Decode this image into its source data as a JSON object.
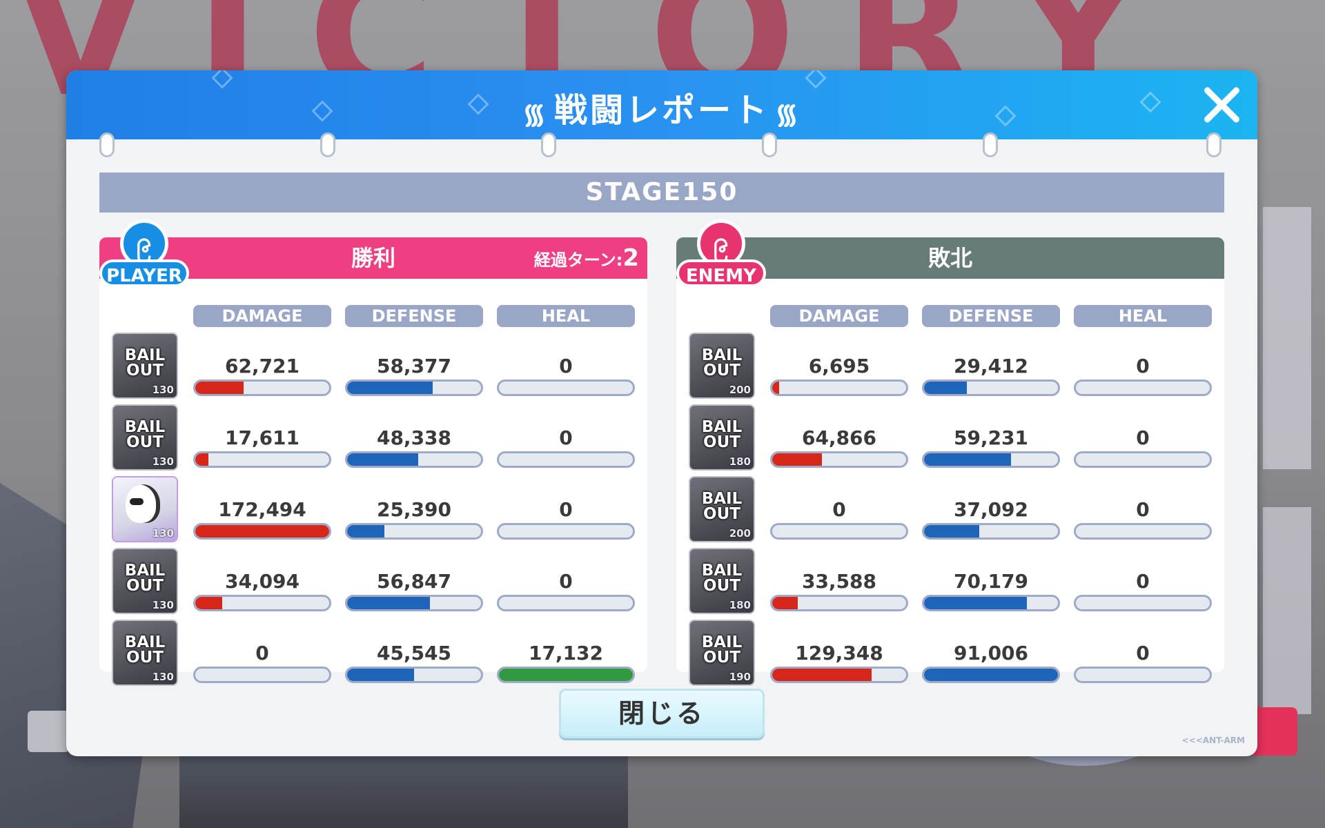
{
  "background": {
    "word": "VICTORY"
  },
  "dialog": {
    "title": "戦闘レポート",
    "stage": "STAGE150",
    "close_button": "閉じる",
    "brand": "<<<ANT-ARM"
  },
  "columns": {
    "damage": "DAMAGE",
    "defense": "DEFENSE",
    "heal": "HEAL"
  },
  "player": {
    "badge": "PLAYER",
    "result": "勝利",
    "turns_label": "経過ターン:",
    "turns": "2",
    "units": [
      {
        "portrait": "BAIL OUT",
        "level": "130",
        "damage": "62,721",
        "defense": "58,377",
        "heal": "0",
        "damage_fill": 0.36,
        "defense_fill": 0.64,
        "heal_fill": 0
      },
      {
        "portrait": "BAIL OUT",
        "level": "130",
        "damage": "17,611",
        "defense": "48,338",
        "heal": "0",
        "damage_fill": 0.1,
        "defense_fill": 0.53,
        "heal_fill": 0
      },
      {
        "portrait": "",
        "level": "130",
        "damage": "172,494",
        "defense": "25,390",
        "heal": "0",
        "damage_fill": 1.0,
        "defense_fill": 0.28,
        "heal_fill": 0
      },
      {
        "portrait": "BAIL OUT",
        "level": "130",
        "damage": "34,094",
        "defense": "56,847",
        "heal": "0",
        "damage_fill": 0.2,
        "defense_fill": 0.62,
        "heal_fill": 0
      },
      {
        "portrait": "BAIL OUT",
        "level": "130",
        "damage": "0",
        "defense": "45,545",
        "heal": "17,132",
        "damage_fill": 0,
        "defense_fill": 0.5,
        "heal_fill": 1.0
      }
    ]
  },
  "enemy": {
    "badge": "ENEMY",
    "result": "敗北",
    "units": [
      {
        "portrait": "BAIL OUT",
        "level": "200",
        "damage": "6,695",
        "defense": "29,412",
        "heal": "0",
        "damage_fill": 0.05,
        "defense_fill": 0.32,
        "heal_fill": 0
      },
      {
        "portrait": "BAIL OUT",
        "level": "180",
        "damage": "64,866",
        "defense": "59,231",
        "heal": "0",
        "damage_fill": 0.37,
        "defense_fill": 0.65,
        "heal_fill": 0
      },
      {
        "portrait": "BAIL OUT",
        "level": "200",
        "damage": "0",
        "defense": "37,092",
        "heal": "0",
        "damage_fill": 0,
        "defense_fill": 0.41,
        "heal_fill": 0
      },
      {
        "portrait": "BAIL OUT",
        "level": "180",
        "damage": "33,588",
        "defense": "70,179",
        "heal": "0",
        "damage_fill": 0.19,
        "defense_fill": 0.77,
        "heal_fill": 0
      },
      {
        "portrait": "BAIL OUT",
        "level": "190",
        "damage": "129,348",
        "defense": "91,006",
        "heal": "0",
        "damage_fill": 0.74,
        "defense_fill": 1.0,
        "heal_fill": 0
      }
    ]
  },
  "colors": {
    "header_blue": "#1f7fe6",
    "player_pink": "#ef3f83",
    "enemy_gray": "#677c78",
    "damage_red": "#d7271a",
    "defense_blue": "#1e64b8",
    "heal_green": "#2f9a3e"
  }
}
